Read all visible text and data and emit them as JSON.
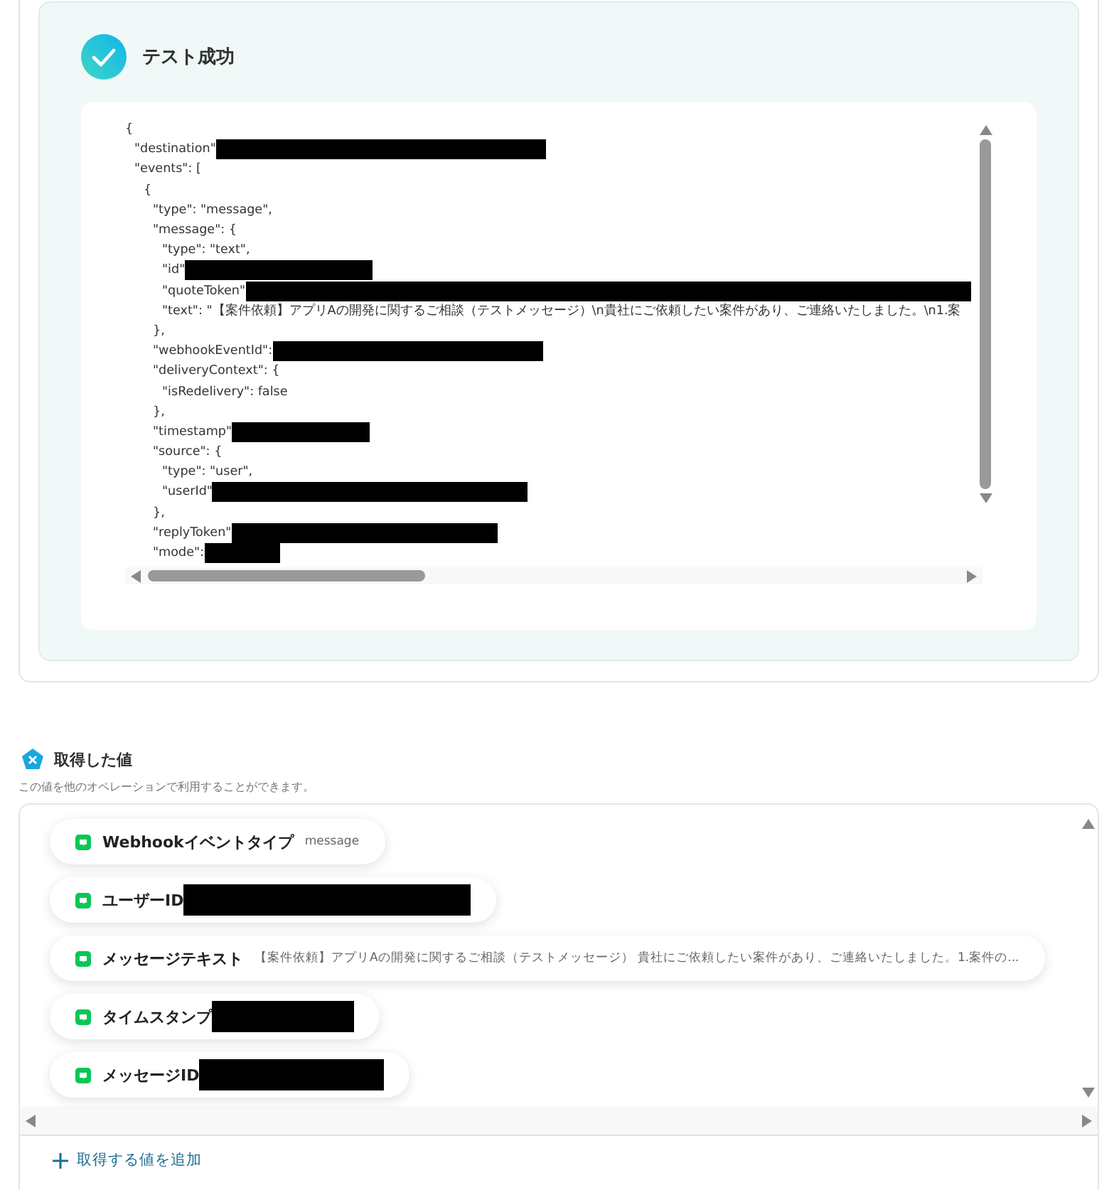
{
  "test_result": {
    "title": "テスト成功",
    "code_lines": [
      {
        "text": "{",
        "children": [
          {
            "text": "\"destination\"",
            "redacted": true
          },
          {
            "text": "\"events\": [",
            "children": [
              {
                "text": "{",
                "children": [
                  {
                    "text": "\"type\": \"message\","
                  },
                  {
                    "text": "\"message\": {",
                    "children": [
                      {
                        "text": "\"type\": \"text\","
                      },
                      {
                        "text": "\"id\"",
                        "redacted": true
                      },
                      {
                        "text": "\"quoteToken\"",
                        "redacted": true
                      },
                      {
                        "text": "\"text\": \"【案件依頼】アプリAの開発に関するご相談（テストメッセージ）\\n貴社にご依頼したい案件があり、ご連絡いたしました。\\n1.案"
                      }
                    ]
                  },
                  {
                    "text": "},"
                  },
                  {
                    "text": "\"webhookEventId\":",
                    "redacted": true
                  },
                  {
                    "text": "\"deliveryContext\": {",
                    "children": [
                      {
                        "text": "\"isRedelivery\": false"
                      }
                    ]
                  },
                  {
                    "text": "},"
                  },
                  {
                    "text": "\"timestamp\"",
                    "redacted": true
                  },
                  {
                    "text": "\"source\": {",
                    "children": [
                      {
                        "text": "\"type\": \"user\","
                      },
                      {
                        "text": "\"userId\"",
                        "redacted": true
                      }
                    ]
                  },
                  {
                    "text": "},"
                  },
                  {
                    "text": "\"replyToken\"",
                    "redacted": true
                  },
                  {
                    "text": "\"mode\":",
                    "redacted": true
                  }
                ]
              }
            ]
          }
        ]
      }
    ]
  },
  "values_section": {
    "title": "取得した値",
    "description": "この値を他のオペレーションで利用することができます。",
    "items": [
      {
        "label": "Webhookイベントタイプ",
        "value": "message",
        "redacted": false
      },
      {
        "label": "ユーザーID",
        "redacted": true
      },
      {
        "label": "メッセージテキスト",
        "value": "【案件依頼】アプリAの開発に関するご相談（テストメッセージ） 貴社にご依頼したい案件があり、ご連絡いたしました。1.案件の...",
        "redacted": false
      },
      {
        "label": "タイムスタンプ",
        "redacted": true
      },
      {
        "label": "メッセージID",
        "redacted": true
      }
    ],
    "add_button": "取得する値を追加"
  }
}
